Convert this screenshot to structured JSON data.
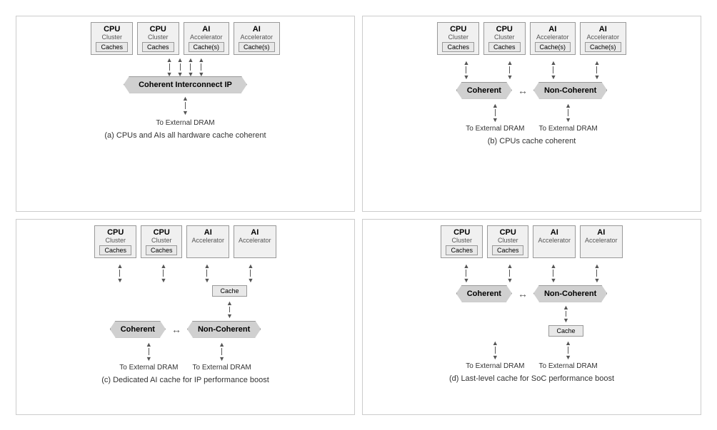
{
  "diagrams": [
    {
      "id": "a",
      "title": "(a) CPUs and AIs all hardware cache coherent",
      "clusters": [
        {
          "title": "CPU",
          "sub": "Cluster",
          "cache": "Caches"
        },
        {
          "title": "CPU",
          "sub": "Cluster",
          "cache": "Caches"
        },
        {
          "title": "AI",
          "sub": "Accelerator",
          "cache": "Cache(s)"
        },
        {
          "title": "AI",
          "sub": "Accelerator",
          "cache": "Cache(s)"
        }
      ],
      "interconnect": "Coherent Interconnect IP",
      "interconnect_type": "single",
      "dram": [
        "To External DRAM"
      ]
    },
    {
      "id": "b",
      "title": "(b) CPUs cache coherent",
      "clusters": [
        {
          "title": "CPU",
          "sub": "Cluster",
          "cache": "Caches"
        },
        {
          "title": "CPU",
          "sub": "Cluster",
          "cache": "Caches"
        },
        {
          "title": "AI",
          "sub": "Accelerator",
          "cache": "Cache(s)"
        },
        {
          "title": "AI",
          "sub": "Accelerator",
          "cache": "Cache(s)"
        }
      ],
      "interconnect": "Coherent",
      "interconnect2": "Non-Coherent",
      "interconnect_type": "double",
      "dram": [
        "To External DRAM",
        "To External DRAM"
      ]
    },
    {
      "id": "c",
      "title": "(c) Dedicated AI cache for IP performance boost",
      "clusters": [
        {
          "title": "CPU",
          "sub": "Cluster",
          "cache": "Caches"
        },
        {
          "title": "CPU",
          "sub": "Cluster",
          "cache": "Caches"
        },
        {
          "title": "AI",
          "sub": "Accelerator",
          "cache": null
        },
        {
          "title": "AI",
          "sub": "Accelerator",
          "cache": null
        }
      ],
      "interconnect": "Coherent",
      "interconnect2": "Non-Coherent",
      "interconnect_type": "double_with_cache",
      "ai_cache": "Cache",
      "dram": [
        "To External DRAM",
        "To External DRAM"
      ]
    },
    {
      "id": "d",
      "title": "(d) Last-level cache for SoC performance boost",
      "clusters": [
        {
          "title": "CPU",
          "sub": "Cluster",
          "cache": "Caches"
        },
        {
          "title": "CPU",
          "sub": "Cluster",
          "cache": "Caches"
        },
        {
          "title": "AI",
          "sub": "Accelerator",
          "cache": null
        },
        {
          "title": "AI",
          "sub": "Accelerator",
          "cache": null
        }
      ],
      "interconnect": "Coherent",
      "interconnect2": "Non-Coherent",
      "interconnect_type": "double_with_cache_below",
      "bottom_cache": "Cache",
      "dram": [
        "To External DRAM",
        "To External DRAM"
      ]
    }
  ]
}
